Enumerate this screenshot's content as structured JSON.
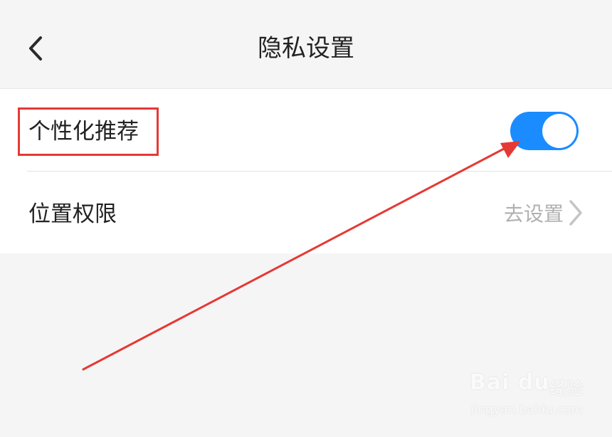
{
  "header": {
    "title": "隐私设置",
    "back_icon": "chevron-left-icon"
  },
  "settings": {
    "personalized": {
      "label": "个性化推荐",
      "enabled": true,
      "toggle_color": "#1a8cff"
    },
    "location": {
      "label": "位置权限",
      "action_label": "去设置",
      "action_icon": "chevron-right-icon"
    }
  },
  "annotation": {
    "highlight_color": "#e53935",
    "arrow_color": "#e53935"
  },
  "watermark": {
    "logo_text": "Bai du",
    "brand_text": "经验",
    "url_text": "jingyan.baidu.com"
  }
}
